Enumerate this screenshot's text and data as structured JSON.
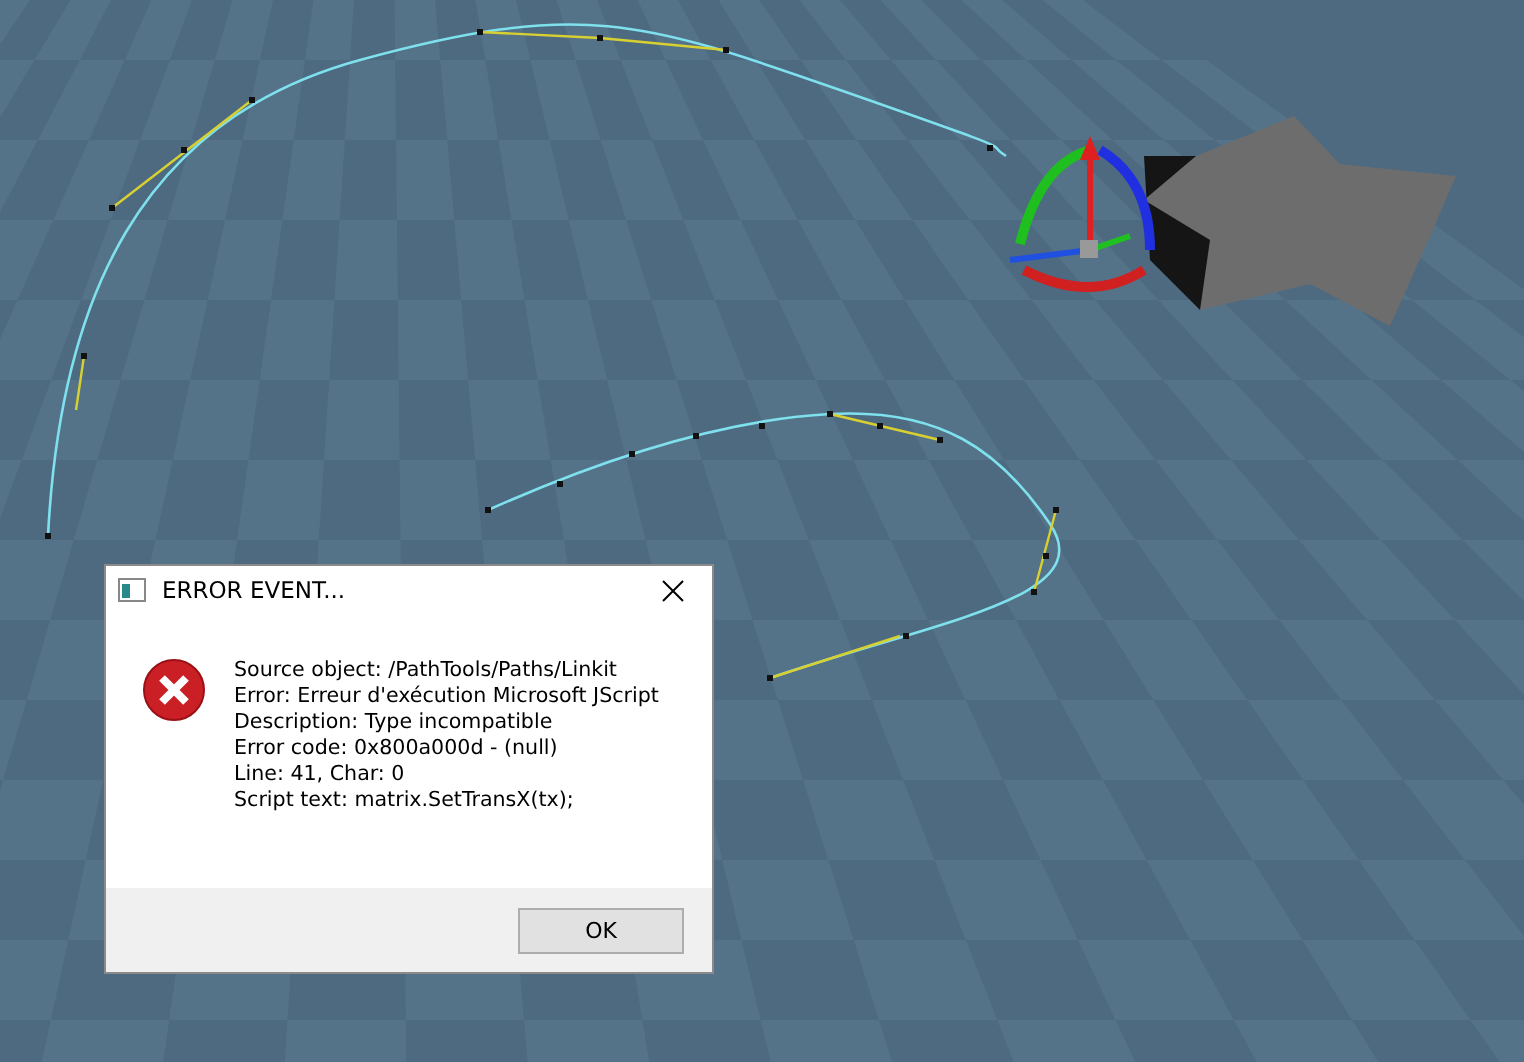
{
  "dialog": {
    "title": "ERROR EVENT...",
    "lines": [
      "Source object: /PathTools/Paths/Linkit",
      "Error: Erreur d'exécution Microsoft JScript",
      "Description: Type incompatible",
      "Error code: 0x800a000d - (null)",
      "Line: 41, Char: 0",
      "Script text:  matrix.SetTransX(tx);"
    ],
    "buttons": [
      "OK"
    ]
  }
}
